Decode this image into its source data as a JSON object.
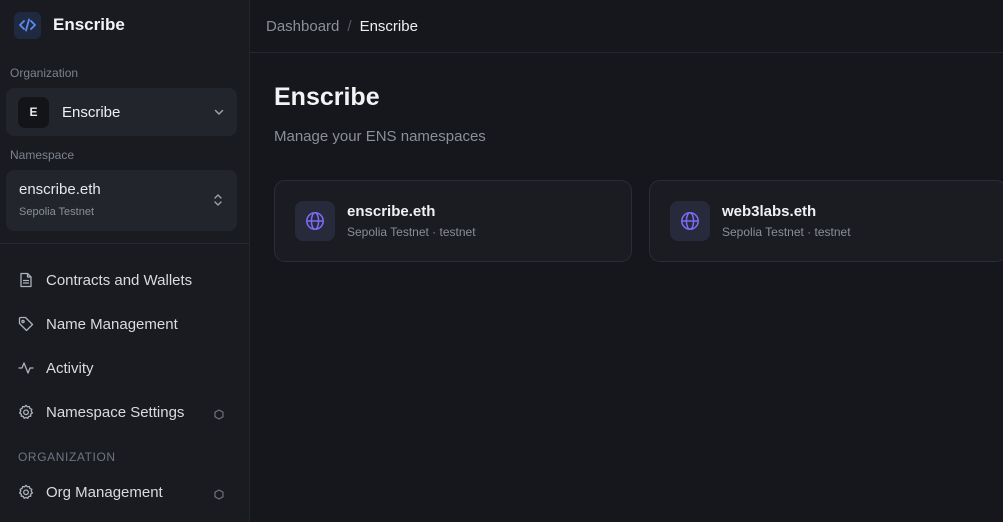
{
  "brand": {
    "name": "Enscribe"
  },
  "organization": {
    "label": "Organization",
    "avatar": "E",
    "name": "Enscribe"
  },
  "namespace": {
    "label": "Namespace",
    "name": "enscribe.eth",
    "network": "Sepolia Testnet"
  },
  "nav": {
    "items": [
      {
        "label": "Contracts and Wallets",
        "icon": "document-icon"
      },
      {
        "label": "Name Management",
        "icon": "tag-icon"
      },
      {
        "label": "Activity",
        "icon": "activity-icon"
      },
      {
        "label": "Namespace Settings",
        "icon": "gear-icon"
      }
    ],
    "org_heading": "ORGANIZATION",
    "org_items": [
      {
        "label": "Org Management",
        "icon": "gear-icon"
      }
    ]
  },
  "breadcrumb": {
    "parent": "Dashboard",
    "separator": "/",
    "current": "Enscribe"
  },
  "page": {
    "title": "Enscribe",
    "subtitle": "Manage your ENS namespaces"
  },
  "cards": [
    {
      "name": "enscribe.eth",
      "meta": "Sepolia Testnet · testnet",
      "icon": "globe-icon"
    },
    {
      "name": "web3labs.eth",
      "meta": "Sepolia Testnet · testnet",
      "icon": "globe-icon"
    }
  ],
  "colors": {
    "accent": "#7b6cf6",
    "brand_icon": "#5b8def",
    "background": "#15171c",
    "sidebar": "#191b21"
  }
}
